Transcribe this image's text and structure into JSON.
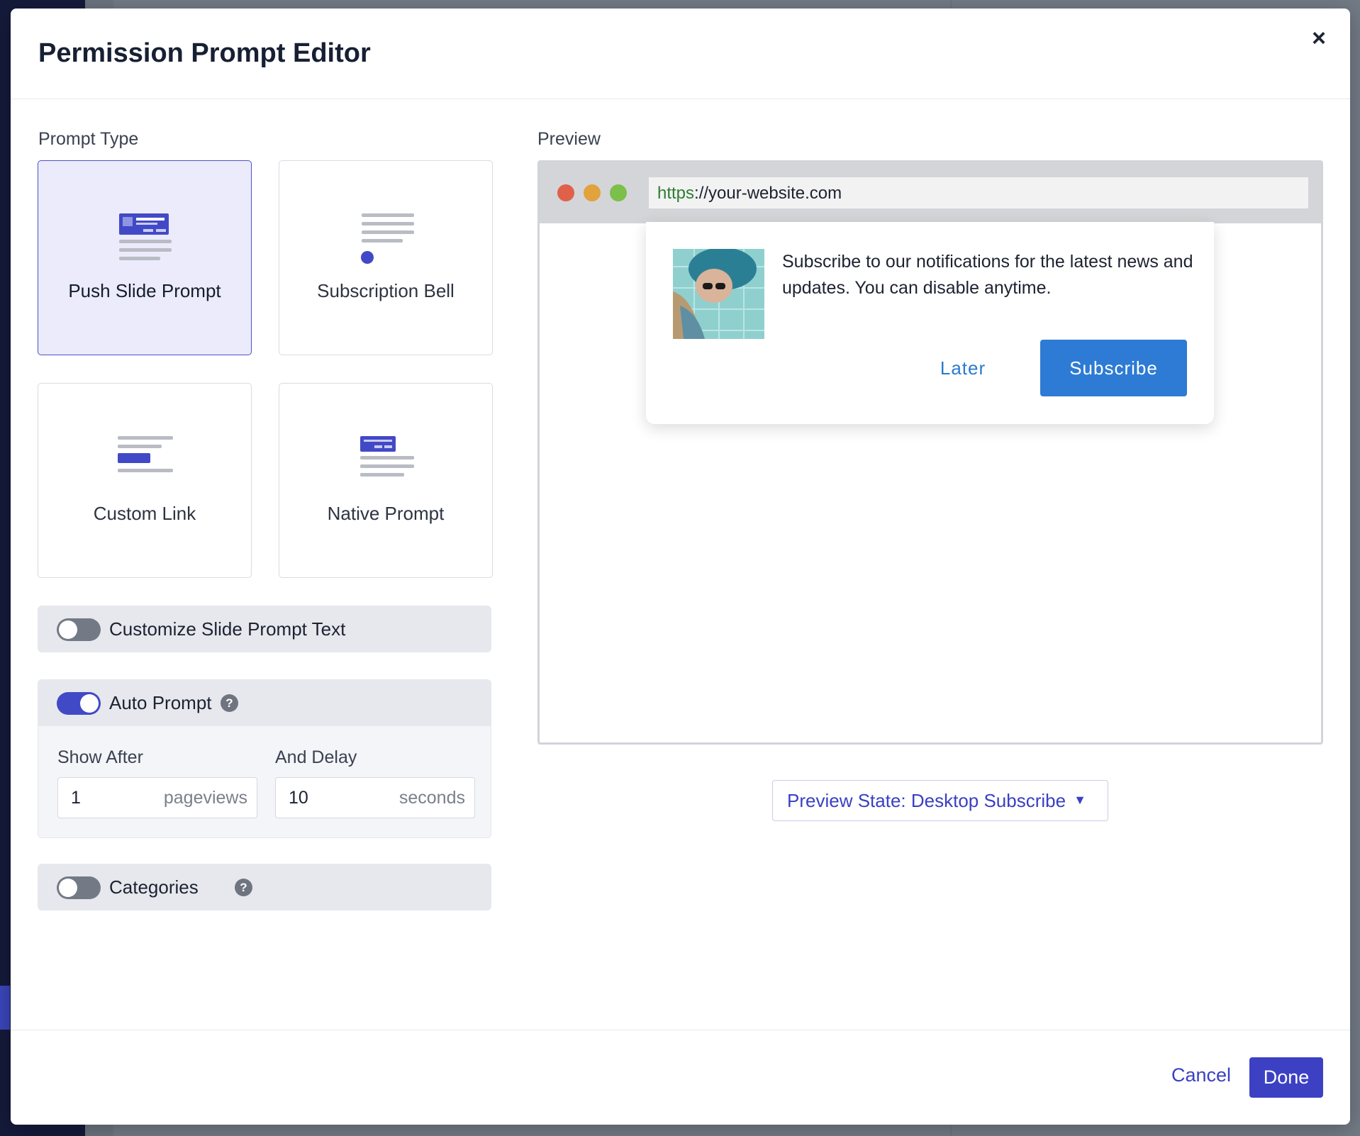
{
  "modal": {
    "title": "Permission Prompt Editor",
    "close_symbol": "×"
  },
  "prompt_type": {
    "label": "Prompt Type",
    "selected": "Push Slide Prompt",
    "cards": [
      {
        "label": "Push Slide Prompt",
        "icon": "push-slide-prompt-icon"
      },
      {
        "label": "Subscription Bell",
        "icon": "subscription-bell-icon"
      },
      {
        "label": "Custom Link",
        "icon": "custom-link-icon"
      },
      {
        "label": "Native Prompt",
        "icon": "native-prompt-icon"
      }
    ]
  },
  "toggles": {
    "customize": {
      "label": "Customize Slide Prompt Text",
      "on": false
    },
    "auto_prompt": {
      "label": "Auto Prompt",
      "on": true,
      "help": "?"
    },
    "categories": {
      "label": "Categories",
      "on": false,
      "help": "?"
    }
  },
  "auto_prompt": {
    "show_after_label": "Show After",
    "show_after_value": "1",
    "show_after_unit": "pageviews",
    "delay_label": "And Delay",
    "delay_value": "10",
    "delay_unit": "seconds"
  },
  "preview": {
    "label": "Preview",
    "url_scheme": "https",
    "url_rest": "://your-website.com",
    "message": "Subscribe to our notifications for the latest news and updates. You can disable anytime.",
    "later_label": "Later",
    "subscribe_label": "Subscribe",
    "state_label": "Preview State: Desktop Subscribe",
    "state_caret": "▼"
  },
  "footer": {
    "cancel_label": "Cancel",
    "done_label": "Done"
  },
  "colors": {
    "accent": "#3c41c4",
    "subscribe_button": "#2d7bd4",
    "dot_red": "#e0604a",
    "dot_yellow": "#e2a23c",
    "dot_green": "#7cbf4a"
  }
}
